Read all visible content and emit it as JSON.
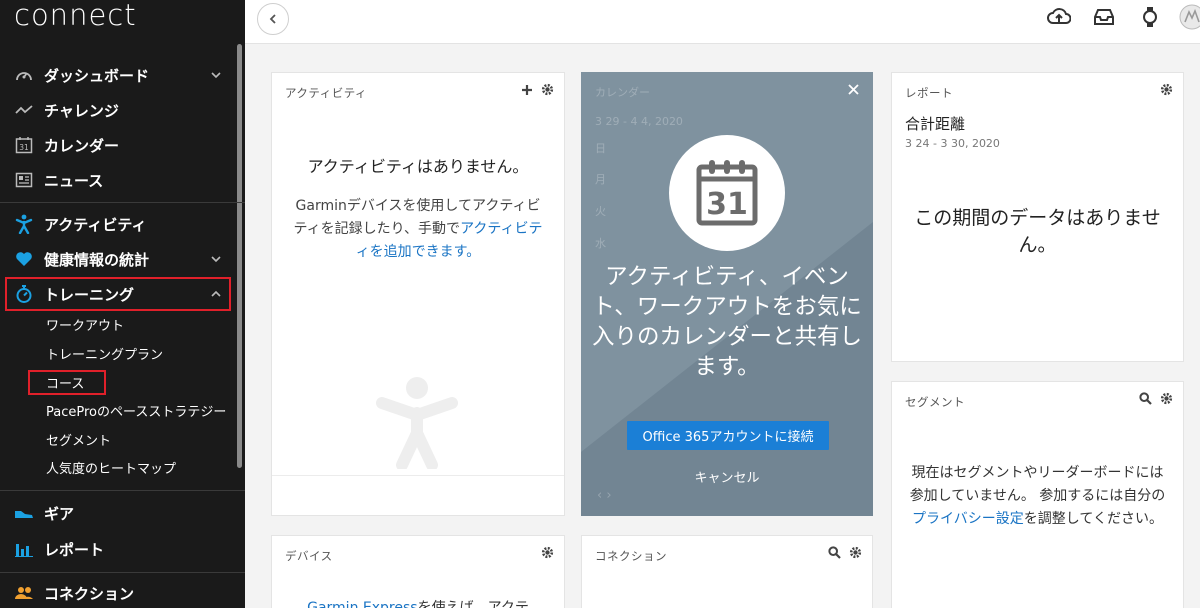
{
  "logo": "connect",
  "sidebar": {
    "items": [
      {
        "label": "ダッシュボード"
      },
      {
        "label": "チャレンジ"
      },
      {
        "label": "カレンダー"
      },
      {
        "label": "ニュース"
      },
      {
        "label": "アクティビティ"
      },
      {
        "label": "健康情報の統計"
      },
      {
        "label": "トレーニング"
      },
      {
        "label": "ギア"
      },
      {
        "label": "レポート"
      },
      {
        "label": "コネクション"
      }
    ],
    "training_sub": [
      "ワークアウト",
      "トレーニングプラン",
      "コース",
      "PaceProのペースストラテジー",
      "セグメント",
      "人気度のヒートマップ"
    ],
    "calendar_icon_day": "31"
  },
  "cards": {
    "activity": {
      "title": "アクティビティ",
      "empty": "アクティビティはありません。",
      "desc1": "Garminデバイスを使用してアクティビティを記録したり、手動で",
      "link": "アクティビティを追加",
      "desc2": "できます。"
    },
    "calendar": {
      "ghost_title": "カレンダー",
      "ghost_date": "3 29 - 4 4, 2020",
      "ghost_days": [
        "日",
        "月",
        "火",
        "水"
      ],
      "icon_day": "31",
      "message": "アクティビティ、イベント、ワークアウトをお気に入りのカレンダーと共有します。",
      "button": "Office 365アカウントに接続",
      "cancel": "キャンセル"
    },
    "report": {
      "title": "レポート",
      "subtitle": "合計距離",
      "date": "3 24 - 3 30, 2020",
      "empty": "この期間のデータはありません。"
    },
    "segment": {
      "title": "セグメント",
      "text1": "現在はセグメントやリーダーボードには参加していません。 参加するには自分の",
      "link": "プライバシー設定",
      "text2": "を調整してください。"
    },
    "device": {
      "title": "デバイス",
      "link": "Garmin Express",
      "text": "を使えば、アクテ"
    },
    "connection": {
      "title": "コネクション"
    }
  }
}
